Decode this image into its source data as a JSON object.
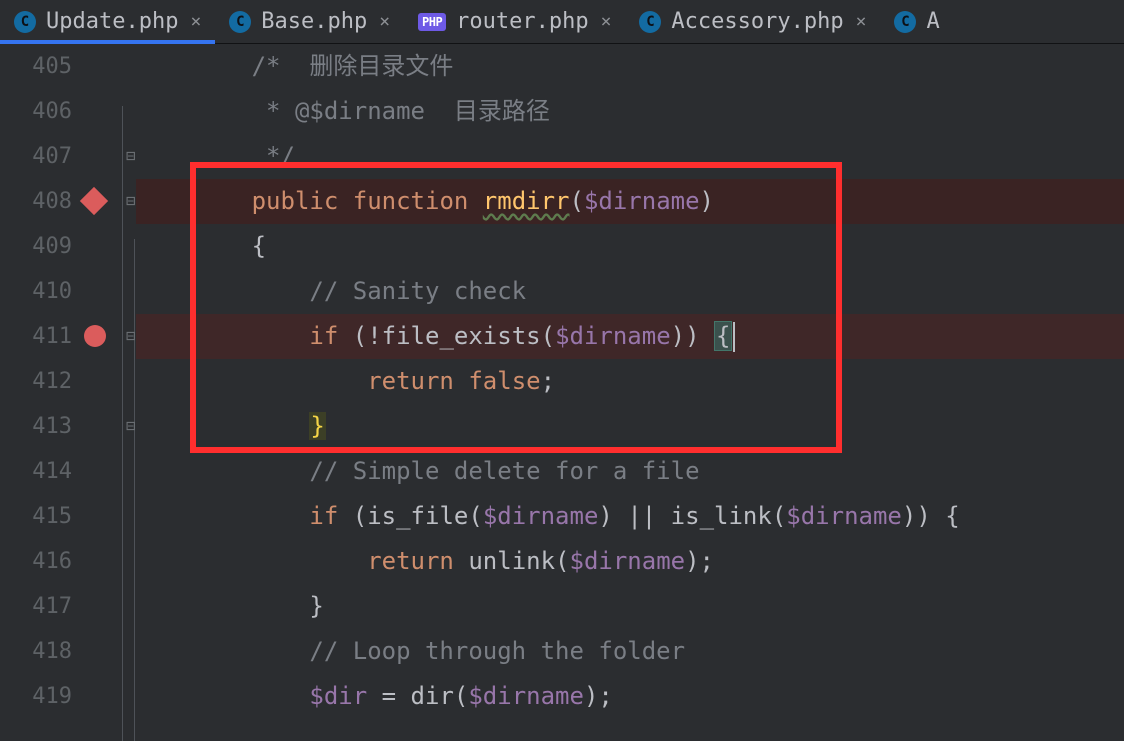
{
  "tabs": [
    {
      "label": "Update.php",
      "iconLetter": "C",
      "active": true,
      "iconKind": "circle"
    },
    {
      "label": "Base.php",
      "iconLetter": "C",
      "active": false,
      "iconKind": "circle"
    },
    {
      "label": "router.php",
      "iconLetter": "PHP",
      "active": false,
      "iconKind": "php"
    },
    {
      "label": "Accessory.php",
      "iconLetter": "C",
      "active": false,
      "iconKind": "circle"
    },
    {
      "label": "A",
      "iconLetter": "C",
      "active": false,
      "iconKind": "circle"
    }
  ],
  "gutter": {
    "start": 405,
    "end": 419
  },
  "breakpoints": {
    "diamondLine": 408,
    "circleLine": 411
  },
  "foldMarks": [
    407,
    408,
    411,
    413
  ],
  "code": {
    "l405_comment": "/*  删除目录文件",
    "l406_comment": " * @$dirname  目录路径",
    "l407_comment": " */",
    "l408_kw1": "public",
    "l408_kw2": "function",
    "l408_func": "rmdirr",
    "l408_var": "$dirname",
    "l409_brace": "{",
    "l410_comment": "// Sanity check",
    "l411_kw": "if",
    "l411_fn": "file_exists",
    "l411_var": "$dirname",
    "l411_bang": "!",
    "l411_brace": "{",
    "l412_kw": "return",
    "l412_bool": "false",
    "l412_semi": ";",
    "l413_brace": "}",
    "l414_comment": "// Simple delete for a file",
    "l415_kw": "if",
    "l415_fn1": "is_file",
    "l415_var1": "$dirname",
    "l415_op": "||",
    "l415_fn2": "is_link",
    "l415_var2": "$dirname",
    "l415_brace": "{",
    "l416_kw": "return",
    "l416_fn": "unlink",
    "l416_var": "$dirname",
    "l416_end": ";",
    "l417_brace": "}",
    "l418_comment": "// Loop through the folder",
    "l419_var1": "$dir",
    "l419_eq": " = ",
    "l419_fn": "dir",
    "l419_var2": "$dirname",
    "l419_end": ";"
  },
  "highlightBox": {
    "topLine": 407,
    "bottomLine": 413,
    "leftPx": 190,
    "widthPx": 652
  }
}
